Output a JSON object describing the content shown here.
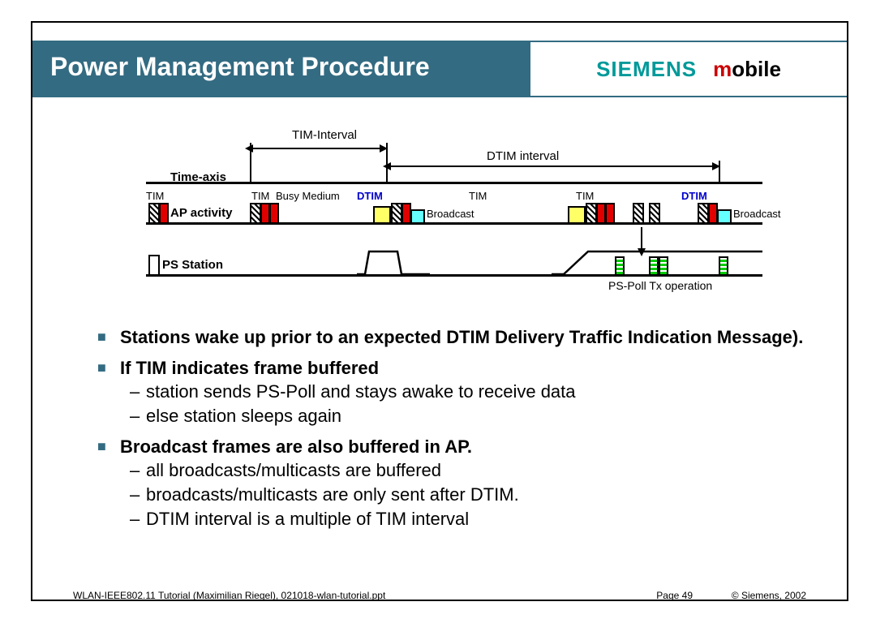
{
  "title": "Power Management Procedure",
  "logo": {
    "siemens": "SIEMENS",
    "m": "m",
    "obile": "obile"
  },
  "diagram": {
    "tim_interval": "TIM-Interval",
    "dtim_interval": "DTIM interval",
    "time_axis": "Time-axis",
    "ap_activity": "AP activity",
    "ps_station": "PS Station",
    "tim": "TIM",
    "dtim": "DTIM",
    "busy_medium": "Busy Medium",
    "broadcast": "Broadcast",
    "ps_poll": "PS-Poll Tx operation"
  },
  "bullets": {
    "b1": "Stations wake up prior to an expected DTIM Delivery Traffic Indication Message).",
    "b2": "If TIM indicates frame buffered",
    "b2a": "station sends PS-Poll and stays awake to receive data",
    "b2b": "else station sleeps again",
    "b3": "Broadcast frames are also buffered in AP.",
    "b3a": "all broadcasts/multicasts are buffered",
    "b3b": "broadcasts/multicasts are only sent after DTIM.",
    "b3c": "DTIM interval is a multiple of TIM interval"
  },
  "footer": {
    "left": "WLAN-IEEE802.11 Tutorial (Maximilian Riegel), 021018-wlan-tutorial.ppt",
    "page": "Page 49",
    "right": "© Siemens, 2002"
  }
}
